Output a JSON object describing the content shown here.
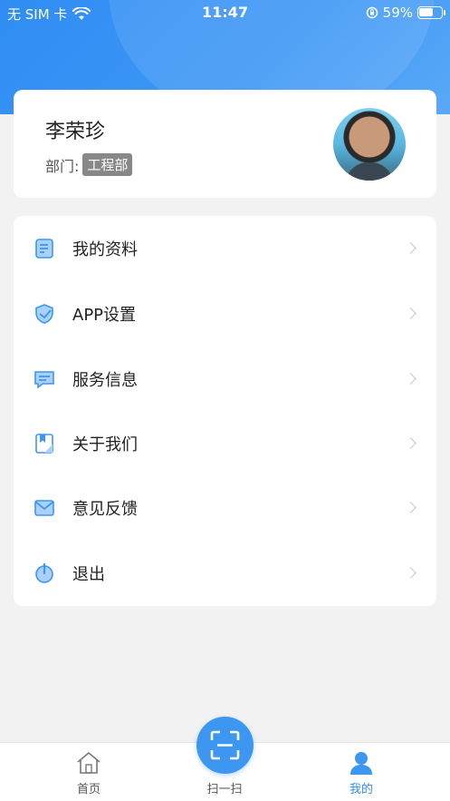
{
  "status_bar": {
    "carrier": "无 SIM 卡",
    "time": "11:47",
    "battery": "59%"
  },
  "profile": {
    "name": "李荣珍",
    "dept_label": "部门:",
    "dept_value": "工程部"
  },
  "menu": [
    {
      "label": "我的资料",
      "icon": "document-icon"
    },
    {
      "label": "APP设置",
      "icon": "shield-icon"
    },
    {
      "label": "服务信息",
      "icon": "message-icon"
    },
    {
      "label": "关于我们",
      "icon": "bookmark-icon"
    },
    {
      "label": "意见反馈",
      "icon": "mail-icon"
    },
    {
      "label": "退出",
      "icon": "power-icon"
    }
  ],
  "tab_bar": {
    "home": "首页",
    "scan": "扫一扫",
    "mine": "我的"
  },
  "colors": {
    "accent": "#2f8cf2",
    "icon_blue": "#3d97f0",
    "icon_light": "#a9d1fb"
  }
}
